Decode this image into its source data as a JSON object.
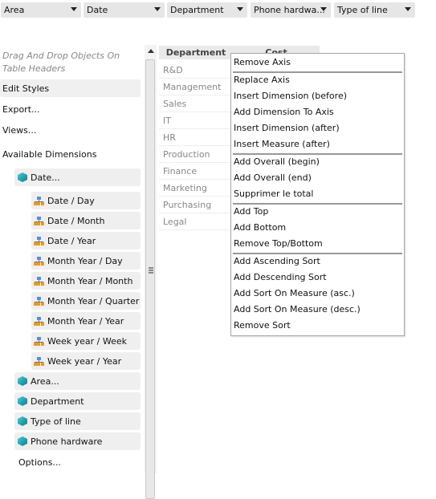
{
  "filters": [
    {
      "label": "Area"
    },
    {
      "label": "Date"
    },
    {
      "label": "Department"
    },
    {
      "label": "Phone hardwa..."
    },
    {
      "label": "Type of line"
    }
  ],
  "left_panel": {
    "hint": "Drag And Drop Objects On Table Headers",
    "edit_styles": "Edit Styles",
    "export": "Export...",
    "views": "Views...",
    "available_dimensions": "Available Dimensions",
    "date_dimension": "Date...",
    "date_hierarchies": [
      "Date / Day",
      "Date / Month",
      "Date / Year",
      "Month Year / Day",
      "Month Year / Month",
      "Month Year / Quarter",
      "Month Year / Year",
      "Week year / Week",
      "Week year / Year"
    ],
    "other_dimensions": [
      "Area...",
      "Department",
      "Type of line",
      "Phone hardware"
    ],
    "options": "Options..."
  },
  "table": {
    "columns": [
      "Department",
      "Cost"
    ],
    "departments": [
      "R&D",
      "Management",
      "Sales",
      "IT",
      "HR",
      "Production",
      "Finance",
      "Marketing",
      "Purchasing",
      "Legal"
    ]
  },
  "context_menu": {
    "groups": [
      [
        "Remove Axis"
      ],
      [
        "Replace Axis",
        "Insert Dimension (before)",
        "Add Dimension To Axis",
        "Insert Dimension (after)",
        "Insert Measure (after)"
      ],
      [
        "Add Overall (begin)",
        "Add Overall (end)",
        "Supprimer le total"
      ],
      [
        "Add Top",
        "Add Bottom",
        "Remove Top/Bottom"
      ],
      [
        "Add Ascending Sort",
        "Add Descending Sort",
        "Add Sort On Measure (asc.)",
        "Add Sort On Measure (desc.)",
        "Remove Sort"
      ]
    ]
  }
}
